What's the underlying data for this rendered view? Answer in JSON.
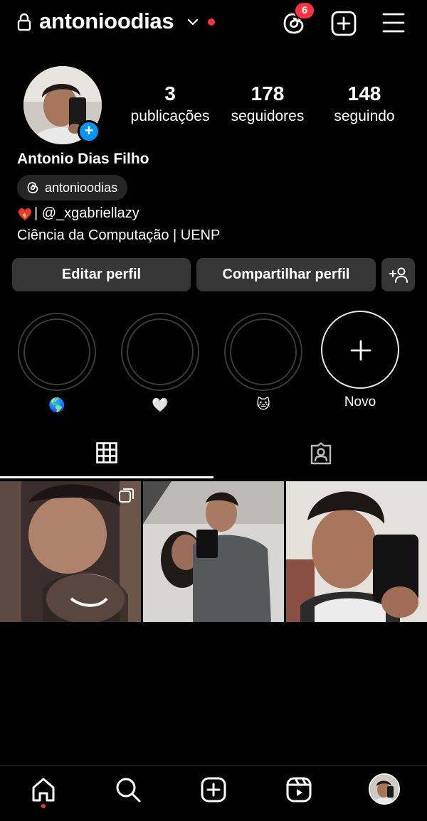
{
  "header": {
    "username": "antonioodias",
    "threads_badge": "6"
  },
  "profile": {
    "stats": [
      {
        "value": "3",
        "label": "publicações"
      },
      {
        "value": "178",
        "label": "seguidores"
      },
      {
        "value": "148",
        "label": "seguindo"
      }
    ],
    "full_name": "Antonio Dias Filho",
    "threads_handle": "antonioodias",
    "bio_line1": "| @_xgabriellazy",
    "bio_line2": "Ciência da Computação | UENP"
  },
  "buttons": {
    "edit": "Editar perfil",
    "share": "Compartilhar perfil"
  },
  "highlights": [
    {
      "label": "🌎"
    },
    {
      "label": "🤍"
    },
    {
      "label": "🐱"
    },
    {
      "label": "Novo"
    }
  ],
  "colors": {
    "background": "#000000",
    "button": "#363636",
    "accent_blue": "#0095f6",
    "notification_red": "#ff3040"
  },
  "icons": {
    "header": [
      "lock-icon",
      "chevron-down-icon",
      "threads-icon",
      "create-post-icon",
      "menu-icon"
    ],
    "tabs": [
      "grid-icon",
      "tagged-icon"
    ],
    "bottom_nav": [
      "home-icon",
      "search-icon",
      "create-icon",
      "reels-icon",
      "profile-avatar"
    ]
  }
}
